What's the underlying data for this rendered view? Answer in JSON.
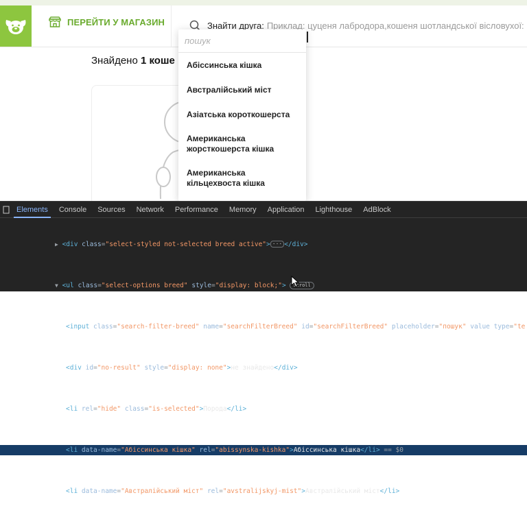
{
  "header": {
    "shop_link": "ПЕРЕЙТИ У МАГАЗИН",
    "search_label": "Знайти друга:",
    "search_placeholder": "Приклад: цуценя лабродора,кошеня шотландської вісловухої:"
  },
  "results": {
    "prefix": "Знайдено",
    "count": "1 коше"
  },
  "dropdown": {
    "search_placeholder": "пошук",
    "items": [
      "Абіссинська кішка",
      "Австралійський міст",
      "Азіатська короткошерста",
      "Американська жорсткошерста кішка",
      "Американська кільцехвоста кішка"
    ]
  },
  "devtools": {
    "tabs": [
      "Elements",
      "Console",
      "Sources",
      "Network",
      "Performance",
      "Memory",
      "Application",
      "Lighthouse",
      "AdBlock"
    ],
    "active_tab": "Elements",
    "scroll_badge": "scroll",
    "ellipsis_badge": "···",
    "lines": {
      "l1_open": "<div ",
      "l1_attr1": "class",
      "l1_val1": "\"select-styled not-selected breed active\"",
      "l1_close": ">",
      "l1_end": "</div>",
      "l2_open": "<ul ",
      "l2_attr1": "class",
      "l2_val1": "\"select-options breed\"",
      "l2_attr2": "style",
      "l2_val2": "\"display: block;\"",
      "l2_close": ">",
      "l3_open": "<input ",
      "l3_attr1": "class",
      "l3_val1": "\"search-filter-breed\"",
      "l3_attr2": "name",
      "l3_val2": "\"searchFilterBreed\"",
      "l3_attr3": "id",
      "l3_val3": "\"searchFilterBreed\"",
      "l3_attr4": "placeholder",
      "l3_val4": "\"пошук\"",
      "l3_attr5": "value type",
      "l3_val5": "\"te",
      "l4_open": "<div ",
      "l4_attr1": "id",
      "l4_val1": "\"no-result\"",
      "l4_attr2": "style",
      "l4_val2": "\"display: none\"",
      "l4_close": ">",
      "l4_text": "не знайдено",
      "l4_end": "</div>",
      "l5_open": "<li ",
      "l5_attr1": "rel",
      "l5_val1": "\"hide\"",
      "l5_attr2": "class",
      "l5_val2": "\"is-selected\"",
      "l5_close": ">",
      "l5_text": "Порода",
      "l5_end": "</li>",
      "l6_open": "<li ",
      "l6_attr1": "data-name",
      "l6_val1": "\"Абіссинська кішка\"",
      "l6_attr2": "rel",
      "l6_val2": "\"abissynska-kishka\"",
      "l6_close": ">",
      "l6_text": "Абіссинська кішка",
      "l6_end": "</li>",
      "l6_eq": " == $0",
      "l7_open": "<li ",
      "l7_attr1": "data-name",
      "l7_val1": "\"Австралійський міст\"",
      "l7_attr2": "rel",
      "l7_val2": "\"avstralijskyj-mist\"",
      "l7_close": ">",
      "l7_text": "Австралійський міст",
      "l7_end": "</li>"
    }
  },
  "colors": {
    "brand_green": "#8dc63f",
    "link_green": "#6aab2e",
    "devtools_bg": "#242424",
    "devtools_accent": "#8ab4f8",
    "selection": "#163c66"
  }
}
